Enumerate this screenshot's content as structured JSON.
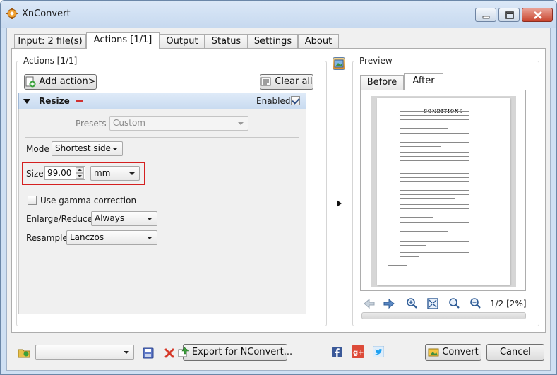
{
  "window": {
    "title": "XnConvert"
  },
  "tabs": [
    {
      "label": "Input: 2 file(s)"
    },
    {
      "label": "Actions [1/1]"
    },
    {
      "label": "Output"
    },
    {
      "label": "Status"
    },
    {
      "label": "Settings"
    },
    {
      "label": "About"
    }
  ],
  "actions_group": {
    "label": "Actions [1/1]",
    "add_action": "Add action>",
    "clear_all": "Clear all",
    "resize": {
      "title": "Resize",
      "enabled_label": "Enabled",
      "enabled": true,
      "presets_label": "Presets",
      "presets_value": "Custom",
      "mode_label": "Mode",
      "mode_value": "Shortest side",
      "size_label": "Size",
      "size_value": "99.00",
      "unit_value": "mm",
      "gamma_label": "Use gamma correction",
      "gamma_checked": false,
      "enlarge_label": "Enlarge/Reduce",
      "enlarge_value": "Always",
      "resample_label": "Resample",
      "resample_value": "Lanczos"
    }
  },
  "preview": {
    "label": "Preview",
    "tab_before": "Before",
    "tab_after": "After",
    "document_heading": "CONDITIONS",
    "page_info": "1/2 [2%]"
  },
  "bottom": {
    "export_label": "Export for NConvert...",
    "convert_label": "Convert",
    "cancel_label": "Cancel"
  },
  "colors": {
    "highlight": "#d42020",
    "facebook": "#3b5998",
    "google_plus": "#dd4b39",
    "twitter": "#1da1f2"
  }
}
